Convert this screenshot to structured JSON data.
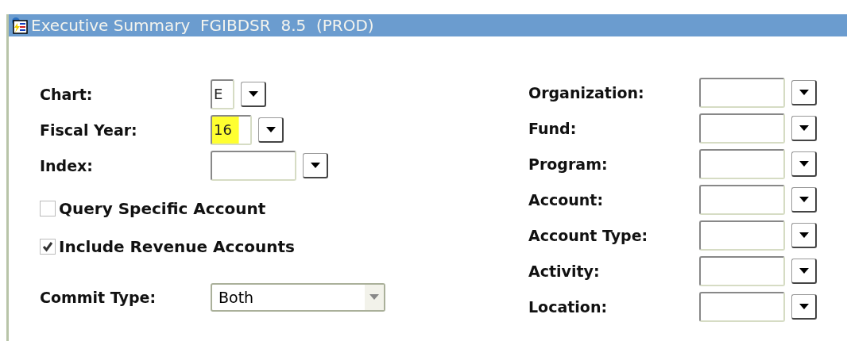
{
  "window": {
    "title": "Executive Summary  FGIBDSR  8.5  (PROD)"
  },
  "left_fields": [
    {
      "label": "Chart:",
      "value": "E",
      "focused": false
    },
    {
      "label": "Fiscal Year:",
      "value": "16",
      "focused": true
    },
    {
      "label": "Index:",
      "focused": false
    }
  ],
  "checkboxes": [
    {
      "label": "Query Specific Account",
      "checked": false
    },
    {
      "label": "Include Revenue Accounts",
      "checked": true
    }
  ],
  "commit_type": {
    "label": "Commit Type:",
    "value": "Both"
  },
  "right_fields": [
    {
      "label": "Organization:"
    },
    {
      "label": "Fund:"
    },
    {
      "label": "Program:"
    },
    {
      "label": "Account:"
    },
    {
      "label": "Account Type:"
    },
    {
      "label": "Activity:"
    },
    {
      "label": "Location:"
    }
  ]
}
